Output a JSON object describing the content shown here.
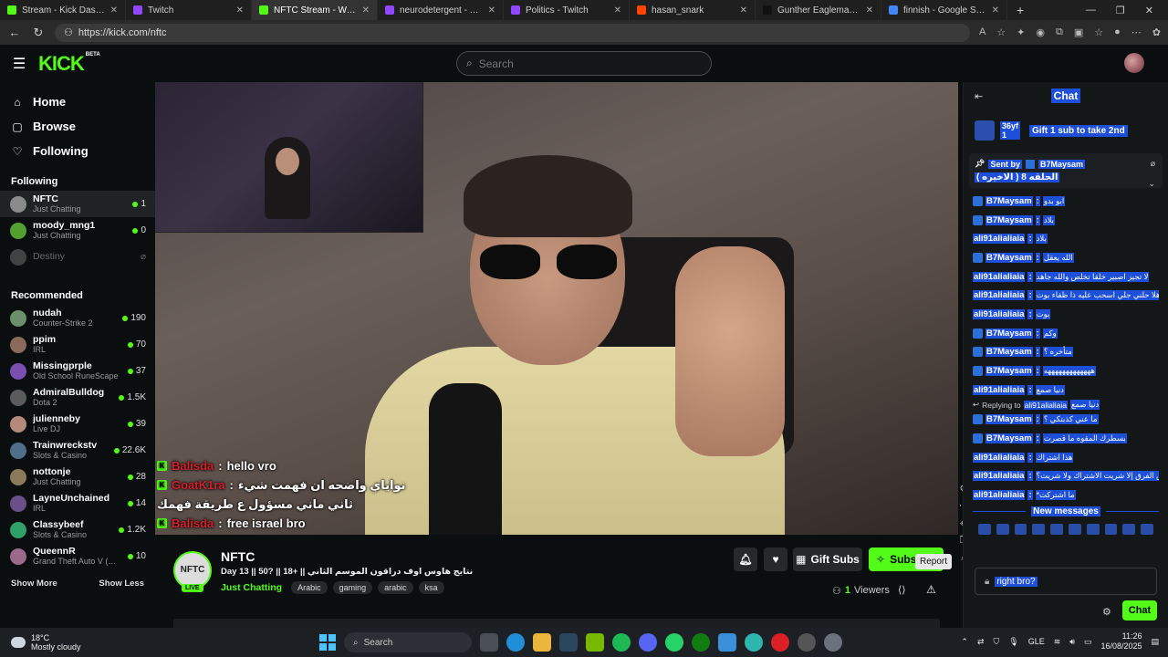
{
  "browser": {
    "tabs": [
      {
        "title": "Stream - Kick Dashboard",
        "color": "#53fc18",
        "active": false
      },
      {
        "title": "Twitch",
        "color": "#9146ff",
        "active": false
      },
      {
        "title": "NFTC Stream - Watch L",
        "color": "#53fc18",
        "active": true
      },
      {
        "title": "neurodetergent - Twitch",
        "color": "#9146ff",
        "active": false
      },
      {
        "title": "Politics - Twitch",
        "color": "#9146ff",
        "active": false
      },
      {
        "title": "hasan_snark",
        "color": "#ff4500",
        "active": false
      },
      {
        "title": "Gunther Eagleman™ (@Gun",
        "color": "#111111",
        "active": false
      },
      {
        "title": "finnish - Google Search",
        "color": "#4285f4",
        "active": false
      }
    ],
    "url": "https://kick.com/nftc"
  },
  "header": {
    "logo": "KICK",
    "logo_beta": "BETA",
    "search_placeholder": "Search"
  },
  "sidebar": {
    "nav": [
      {
        "label": "Home",
        "icon": "home-icon",
        "glyph": "⌂"
      },
      {
        "label": "Browse",
        "icon": "browse-icon",
        "glyph": "▢"
      },
      {
        "label": "Following",
        "icon": "heart-icon",
        "glyph": "♡"
      }
    ],
    "following_title": "Following",
    "following": [
      {
        "name": "NFTC",
        "category": "Just Chatting",
        "viewers": "1",
        "color": "#8a8a8a",
        "selected": true,
        "offline": false
      },
      {
        "name": "moody_mng1",
        "category": "Just Chatting",
        "viewers": "0",
        "color": "#53a030",
        "selected": false,
        "offline": false
      },
      {
        "name": "Destiny",
        "category": "",
        "viewers": "",
        "color": "#777777",
        "selected": false,
        "offline": true
      }
    ],
    "recommended_title": "Recommended",
    "recommended": [
      {
        "name": "nudah",
        "category": "Counter-Strike 2",
        "viewers": "190",
        "color": "#6b8f6b"
      },
      {
        "name": "ppim",
        "category": "IRL",
        "viewers": "70",
        "color": "#8a6a5a"
      },
      {
        "name": "Missingprple",
        "category": "Old School RuneScape",
        "viewers": "37",
        "color": "#7a4fb0"
      },
      {
        "name": "AdmiralBulldog",
        "category": "Dota 2",
        "viewers": "1.5K",
        "color": "#5a5a5a"
      },
      {
        "name": "julienneby",
        "category": "Live DJ",
        "viewers": "39",
        "color": "#b58a7a"
      },
      {
        "name": "Trainwreckstv",
        "category": "Slots & Casino",
        "viewers": "22.6K",
        "color": "#4f6e8a"
      },
      {
        "name": "nottonje",
        "category": "Just Chatting",
        "viewers": "28",
        "color": "#8a7a5a"
      },
      {
        "name": "LayneUnchained",
        "category": "IRL",
        "viewers": "14",
        "color": "#6a4f8a"
      },
      {
        "name": "Classybeef",
        "category": "Slots & Casino",
        "viewers": "1.2K",
        "color": "#2fa06a"
      },
      {
        "name": "QueennR",
        "category": "Grand Theft Auto V (GTA)",
        "viewers": "10",
        "color": "#9a6a8a"
      }
    ],
    "show_more": "Show More",
    "show_less": "Show Less"
  },
  "overlay_chat": [
    {
      "user": "Balisda",
      "sep": ":",
      "text": "hello vro"
    },
    {
      "user": "GoatK1ra",
      "sep": ":",
      "text": "نواياي واضحه ان فهمت شيء"
    },
    {
      "user": "",
      "sep": "",
      "text": "ثاني ماني مسؤول ع طريقة فهمك"
    },
    {
      "user": "Balisda",
      "sep": ":",
      "text": "free israel bro"
    }
  ],
  "stream": {
    "avatar_text": "NFTC",
    "live": "LIVE",
    "name": "NFTC",
    "title": "Day 13 || 50? || 18+ || نتايج هاوس اوف دراقون الموسم الثاني",
    "category": "Just Chatting",
    "tags": [
      "Arabic",
      "gaming",
      "arabic",
      "ksa"
    ],
    "gift_subs": "Gift Subs",
    "subscribe": "Subscribe",
    "viewers_count": "1",
    "viewers_label": "Viewers",
    "report_tooltip": "Report"
  },
  "chat": {
    "title": "Chat",
    "gift_count_top": "36yf",
    "gift_count_bottom": "1",
    "gift_text": "Gift 1 sub to take 2nd",
    "pinned_sent_by": "Sent by",
    "pinned_user": "B7Maysam",
    "pinned_message": "الحلقه 8 ( الاخيره )",
    "messages": [
      {
        "user": "B7Maysam",
        "text": "ابو بدو",
        "badge": true
      },
      {
        "user": "B7Maysam",
        "text": "بلاد",
        "badge": true
      },
      {
        "user": "ali91alialiaia",
        "text": "بلاد",
        "badge": false
      },
      {
        "user": "B7Maysam",
        "text": "الله يعقل",
        "badge": true
      },
      {
        "user": "ali91alialiaia",
        "text": "لا تجيز اصبير خلقا تخلص والله جاهد",
        "badge": false
      },
      {
        "user": "ali91alialiaia",
        "text": "هلا حلني جلي اسحب عليه ذا ظفاء بوت",
        "badge": false
      },
      {
        "user": "ali91alialiaia",
        "text": "بوت",
        "badge": false
      },
      {
        "user": "B7Maysam",
        "text": "وكم",
        "badge": true
      },
      {
        "user": "B7Maysam",
        "text": "متأخره ؟",
        "badge": true
      },
      {
        "user": "B7Maysam",
        "text": "هههههههههههههه",
        "badge": true
      },
      {
        "user": "ali91alialiaia",
        "text": "دنيا صمع",
        "badge": false
      }
    ],
    "reply_to_label": "Replying to",
    "reply_to_user": "ali91alialiaia",
    "reply_to_text": "دنيا صمع",
    "messages2": [
      {
        "user": "B7Maysam",
        "text": "ما عني كذبتكي ؟",
        "badge": true
      },
      {
        "user": "B7Maysam",
        "text": "بسطرك المقوه ما قصرت",
        "badge": true
      },
      {
        "user": "ali91alialiaia",
        "text": "هذا اشتراك",
        "badge": false
      },
      {
        "user": "ali91alialiaia",
        "text": "وش الفرق إلا شريت الاشتراك ولا شريت؟",
        "badge": false
      },
      {
        "user": "ali91alialiaia",
        "text": "*ما اشتركت",
        "badge": false
      }
    ],
    "new_messages": "New messages",
    "input_value": "right bro?",
    "send_label": "Chat"
  },
  "taskbar": {
    "temp": "18°C",
    "weather": "Mostly cloudy",
    "search": "Search",
    "lang": "GLE",
    "time": "11:26",
    "date": "16/08/2025"
  }
}
